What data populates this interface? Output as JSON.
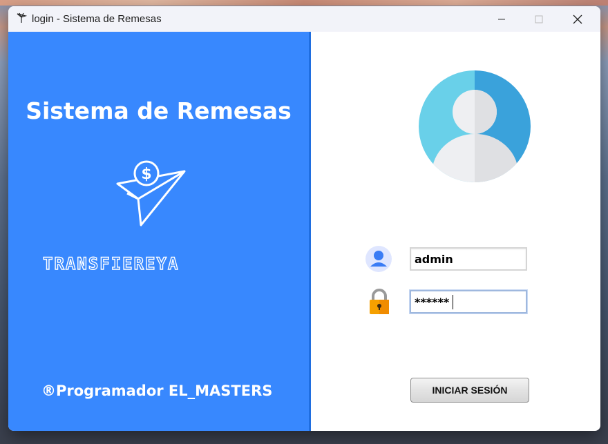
{
  "window": {
    "title": "login - Sistema de Remesas",
    "controls": [
      "minimize",
      "maximize",
      "close"
    ]
  },
  "left_panel": {
    "heading": "Sistema de Remesas",
    "logo_text": "TRANSFIEREYA",
    "footer": "®Programador EL_MASTERS",
    "icon": "paper-plane-dollar-icon",
    "bg_color": "#3888fe"
  },
  "login_form": {
    "avatar_icon": "user-avatar-icon",
    "username_value": "admin",
    "password_value": "******",
    "submit_label": "INICIAR SESIÓN"
  }
}
